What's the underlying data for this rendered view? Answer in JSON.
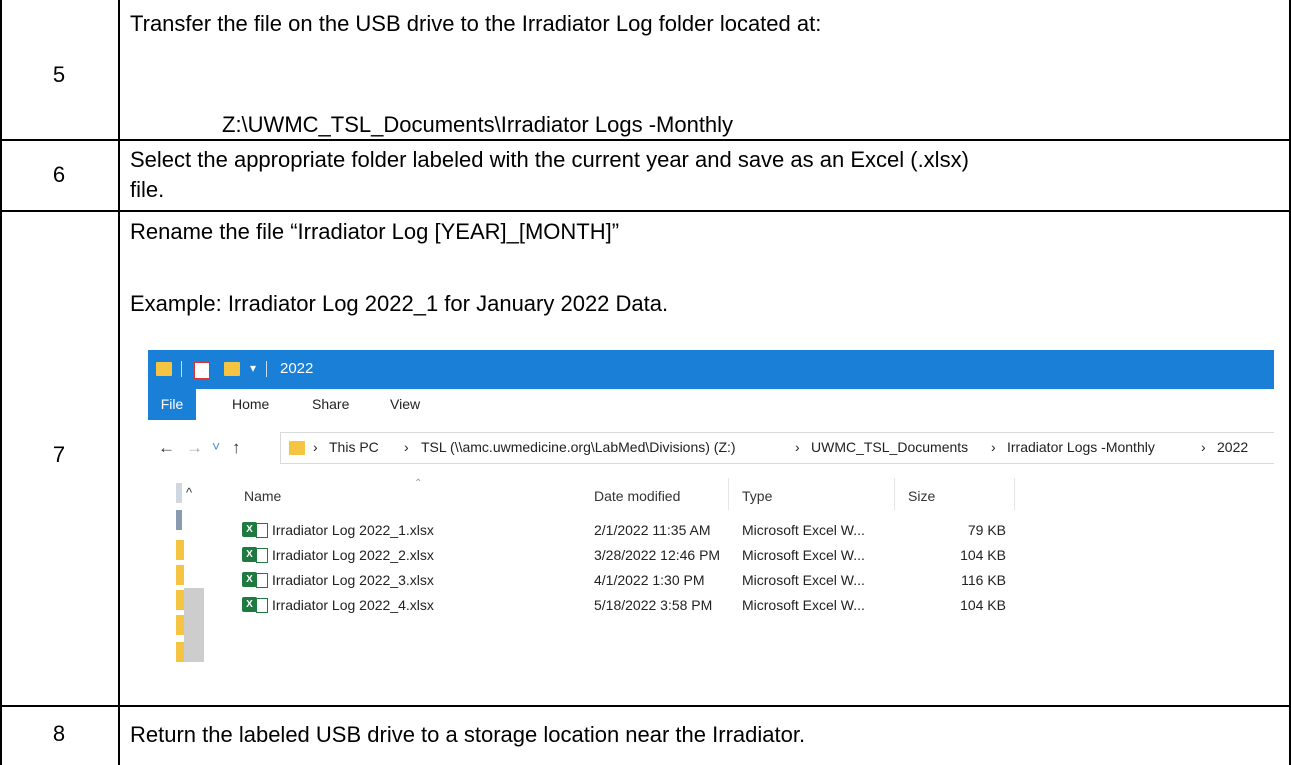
{
  "steps": [
    {
      "number": "5",
      "line1": "Transfer the file on the USB drive to the Irradiator Log folder located at:",
      "path": "Z:\\UWMC_TSL_Documents\\Irradiator Logs -Monthly"
    },
    {
      "number": "6",
      "line1": "Select the appropriate folder labeled with the current year and save as an Excel (.xlsx)",
      "line2": "file."
    },
    {
      "number": "7",
      "line1": "Rename the file “Irradiator Log [YEAR]_[MONTH]”",
      "line2": "Example: Irradiator Log 2022_1 for January 2022 Data."
    },
    {
      "number": "8",
      "line1": "Return the labeled USB drive to a storage location near the Irradiator."
    }
  ],
  "explorer": {
    "title": "2022",
    "ribbon_tabs": [
      "File",
      "Home",
      "Share",
      "View"
    ],
    "breadcrumb": [
      "This PC",
      "TSL (\\\\amc.uwmedicine.org\\LabMed\\Divisions) (Z:)",
      "UWMC_TSL_Documents",
      "Irradiator Logs -Monthly",
      "2022"
    ],
    "columns": [
      "Name",
      "Date modified",
      "Type",
      "Size"
    ],
    "files": [
      {
        "name": "Irradiator Log 2022_1.xlsx",
        "date": "2/1/2022 11:35 AM",
        "type": "Microsoft Excel W...",
        "size": "79 KB"
      },
      {
        "name": "Irradiator Log 2022_2.xlsx",
        "date": "3/28/2022 12:46 PM",
        "type": "Microsoft Excel W...",
        "size": "104 KB"
      },
      {
        "name": "Irradiator Log 2022_3.xlsx",
        "date": "4/1/2022 1:30 PM",
        "type": "Microsoft Excel W...",
        "size": "116 KB"
      },
      {
        "name": "Irradiator Log 2022_4.xlsx",
        "date": "5/18/2022 3:58 PM",
        "type": "Microsoft Excel W...",
        "size": "104 KB"
      }
    ],
    "icons": {
      "back": "←",
      "forward": "→",
      "recent": "˅",
      "up": "↑",
      "chevron": "›",
      "sort": "^",
      "excel": "X"
    },
    "colors": {
      "titlebar": "#1a7fd6",
      "folder": "#f5c443",
      "excel": "#1f7a3f"
    }
  }
}
